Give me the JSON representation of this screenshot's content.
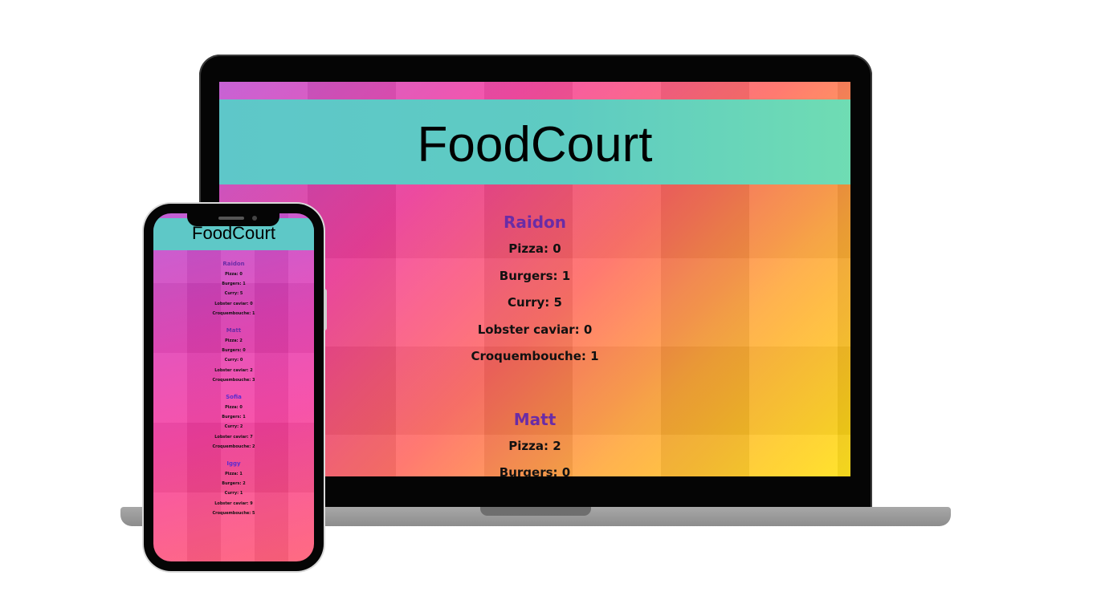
{
  "app": {
    "title": "FoodCourt"
  },
  "people": [
    {
      "name": "Raidon",
      "items": [
        "Pizza: 0",
        "Burgers: 1",
        "Curry: 5",
        "Lobster caviar: 0",
        "Croquembouche: 1"
      ]
    },
    {
      "name": "Matt",
      "items": [
        "Pizza: 2",
        "Burgers: 0",
        "Curry: 0",
        "Lobster caviar: 2",
        "Croquembouche: 3"
      ]
    },
    {
      "name": "Sofia",
      "items": [
        "Pizza: 0",
        "Burgers: 1",
        "Curry: 2",
        "Lobster caviar: 7",
        "Croquembouche: 2"
      ]
    },
    {
      "name": "Iggy",
      "items": [
        "Pizza: 1",
        "Burgers: 2",
        "Curry: 1",
        "Lobster caviar: 9",
        "Croquembouche: 5"
      ]
    }
  ],
  "colors": {
    "header": "#5ec8c7",
    "name": "#6a2ca6",
    "text": "#111111"
  }
}
